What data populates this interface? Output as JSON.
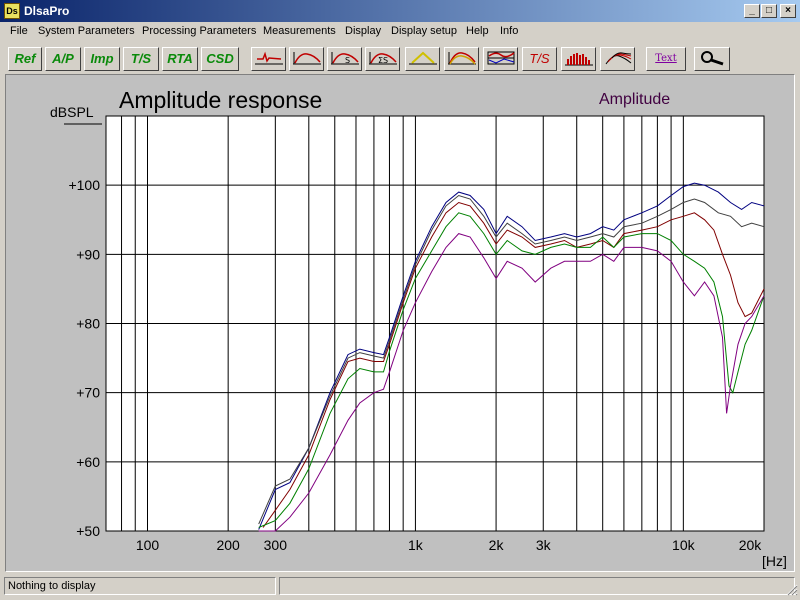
{
  "window": {
    "title": "DlsaPro",
    "app_icon": "Ds"
  },
  "menu": [
    "File",
    "System Parameters",
    "Processing Parameters",
    "Measurements",
    "Display",
    "Display setup",
    "Help",
    "Info"
  ],
  "toolbar": {
    "text_buttons": [
      "Ref",
      "A/P",
      "Imp",
      "T/S",
      "RTA",
      "CSD"
    ],
    "icon_buttons": [
      "impulse-icon",
      "amplitude-icon",
      "sigma-icon",
      "sum-sigma-icon",
      "window-icon",
      "double-curve-icon",
      "phase-icon",
      "ts-icon",
      "rta-bars-icon",
      "waterfall-icon"
    ],
    "ts_icon_label": "T/S",
    "text_tool_label": "Text",
    "zoom_icon": "magnifier-icon"
  },
  "chart_data": {
    "type": "line",
    "title": "Amplitude response",
    "legend_label": "Amplitude",
    "ylabel": "dBSPL",
    "xlabel": "[Hz]",
    "xscale": "log",
    "xlim": [
      70,
      20000
    ],
    "ylim": [
      50,
      110
    ],
    "grid": true,
    "x_ticks": [
      {
        "value": 100,
        "label": "100"
      },
      {
        "value": 200,
        "label": "200"
      },
      {
        "value": 300,
        "label": "300"
      },
      {
        "value": 1000,
        "label": "1k"
      },
      {
        "value": 2000,
        "label": "2k"
      },
      {
        "value": 3000,
        "label": "3k"
      },
      {
        "value": 10000,
        "label": "10k"
      },
      {
        "value": 20000,
        "label": "20k"
      }
    ],
    "y_ticks": [
      {
        "value": 50,
        "label": "+50"
      },
      {
        "value": 60,
        "label": "+60"
      },
      {
        "value": 70,
        "label": "+70"
      },
      {
        "value": 80,
        "label": "+80"
      },
      {
        "value": 90,
        "label": "+90"
      },
      {
        "value": 100,
        "label": "+100"
      }
    ],
    "colors": {
      "background": "#ffffff",
      "grid": "#000000",
      "title": "#000000",
      "legend": "#400040"
    },
    "series": [
      {
        "color": "#000080",
        "points": [
          [
            260,
            50.2
          ],
          [
            300,
            56
          ],
          [
            340,
            57
          ],
          [
            400,
            62
          ],
          [
            480,
            70
          ],
          [
            560,
            75.5
          ],
          [
            620,
            76.3
          ],
          [
            700,
            75.8
          ],
          [
            760,
            75.5
          ],
          [
            800,
            78
          ],
          [
            900,
            84
          ],
          [
            1000,
            89
          ],
          [
            1150,
            94
          ],
          [
            1300,
            97.5
          ],
          [
            1450,
            99
          ],
          [
            1600,
            98.5
          ],
          [
            1800,
            96.5
          ],
          [
            2000,
            93
          ],
          [
            2200,
            95.5
          ],
          [
            2500,
            94
          ],
          [
            2800,
            92
          ],
          [
            3200,
            92.5
          ],
          [
            3600,
            93
          ],
          [
            4000,
            92.5
          ],
          [
            4500,
            93
          ],
          [
            5000,
            94
          ],
          [
            5500,
            93.5
          ],
          [
            6000,
            95
          ],
          [
            7000,
            96
          ],
          [
            8000,
            97
          ],
          [
            9000,
            98.5
          ],
          [
            10000,
            99.8
          ],
          [
            11000,
            100.3
          ],
          [
            12000,
            100
          ],
          [
            13500,
            99
          ],
          [
            15000,
            97.5
          ],
          [
            16500,
            96.5
          ],
          [
            18000,
            97.5
          ],
          [
            20000,
            97
          ]
        ]
      },
      {
        "color": "#404040",
        "points": [
          [
            260,
            51
          ],
          [
            300,
            56.5
          ],
          [
            340,
            57.5
          ],
          [
            400,
            62
          ],
          [
            480,
            69.5
          ],
          [
            560,
            75
          ],
          [
            620,
            75.8
          ],
          [
            700,
            75.3
          ],
          [
            760,
            75
          ],
          [
            800,
            77.5
          ],
          [
            900,
            83.5
          ],
          [
            1000,
            88.5
          ],
          [
            1150,
            93.5
          ],
          [
            1300,
            97
          ],
          [
            1450,
            98.5
          ],
          [
            1600,
            98
          ],
          [
            1800,
            95.5
          ],
          [
            2000,
            92.5
          ],
          [
            2200,
            94.5
          ],
          [
            2500,
            93
          ],
          [
            2800,
            91.5
          ],
          [
            3200,
            92
          ],
          [
            3600,
            92.5
          ],
          [
            4000,
            92
          ],
          [
            4500,
            92.5
          ],
          [
            5000,
            93
          ],
          [
            5500,
            92.5
          ],
          [
            6000,
            94
          ],
          [
            7000,
            94.5
          ],
          [
            8000,
            95.5
          ],
          [
            9000,
            96.5
          ],
          [
            10000,
            97.5
          ],
          [
            11000,
            98
          ],
          [
            12000,
            97.5
          ],
          [
            13500,
            96
          ],
          [
            15000,
            95.5
          ],
          [
            16500,
            94
          ],
          [
            18000,
            94.5
          ],
          [
            20000,
            94
          ]
        ]
      },
      {
        "color": "#800000",
        "points": [
          [
            270,
            50.5
          ],
          [
            300,
            53
          ],
          [
            340,
            56
          ],
          [
            400,
            61
          ],
          [
            480,
            69
          ],
          [
            560,
            74.5
          ],
          [
            620,
            75
          ],
          [
            700,
            74.5
          ],
          [
            760,
            74.5
          ],
          [
            800,
            77
          ],
          [
            900,
            83
          ],
          [
            1000,
            88
          ],
          [
            1150,
            92.5
          ],
          [
            1300,
            96
          ],
          [
            1450,
            97.5
          ],
          [
            1600,
            97
          ],
          [
            1800,
            94.5
          ],
          [
            2000,
            91.5
          ],
          [
            2200,
            93.5
          ],
          [
            2500,
            92.5
          ],
          [
            2800,
            91
          ],
          [
            3200,
            91.5
          ],
          [
            3600,
            92
          ],
          [
            4000,
            91
          ],
          [
            4500,
            91.5
          ],
          [
            5000,
            92
          ],
          [
            5500,
            91
          ],
          [
            6000,
            93
          ],
          [
            7000,
            93.5
          ],
          [
            8000,
            94
          ],
          [
            9000,
            95
          ],
          [
            10000,
            95.5
          ],
          [
            11000,
            96
          ],
          [
            12000,
            95
          ],
          [
            13000,
            93.5
          ],
          [
            14000,
            90
          ],
          [
            15000,
            87
          ],
          [
            16000,
            83
          ],
          [
            17000,
            81
          ],
          [
            18000,
            81.5
          ],
          [
            20000,
            85
          ]
        ]
      },
      {
        "color": "#008000",
        "points": [
          [
            260,
            50.5
          ],
          [
            300,
            51.5
          ],
          [
            340,
            54
          ],
          [
            400,
            59
          ],
          [
            480,
            67
          ],
          [
            560,
            72
          ],
          [
            620,
            73.5
          ],
          [
            700,
            73
          ],
          [
            760,
            73
          ],
          [
            800,
            76
          ],
          [
            900,
            82
          ],
          [
            1000,
            86.5
          ],
          [
            1150,
            90.5
          ],
          [
            1300,
            94
          ],
          [
            1450,
            96
          ],
          [
            1600,
            95.5
          ],
          [
            1800,
            93
          ],
          [
            2000,
            90
          ],
          [
            2200,
            92
          ],
          [
            2500,
            90.5
          ],
          [
            2800,
            90
          ],
          [
            3200,
            91
          ],
          [
            3600,
            91.5
          ],
          [
            4000,
            91
          ],
          [
            4500,
            91
          ],
          [
            5000,
            92.5
          ],
          [
            5500,
            91
          ],
          [
            6000,
            92.5
          ],
          [
            7000,
            93
          ],
          [
            8000,
            93
          ],
          [
            9000,
            92
          ],
          [
            10000,
            90
          ],
          [
            11000,
            89
          ],
          [
            12000,
            88
          ],
          [
            13000,
            86
          ],
          [
            14000,
            81
          ],
          [
            14800,
            71
          ],
          [
            15300,
            70
          ],
          [
            16000,
            73
          ],
          [
            17000,
            77
          ],
          [
            18000,
            79
          ],
          [
            20000,
            84
          ]
        ]
      },
      {
        "color": "#800080",
        "points": [
          [
            260,
            50
          ],
          [
            300,
            50
          ],
          [
            340,
            52
          ],
          [
            400,
            55.5
          ],
          [
            480,
            61
          ],
          [
            560,
            66
          ],
          [
            620,
            68.5
          ],
          [
            700,
            70
          ],
          [
            760,
            70.5
          ],
          [
            800,
            73
          ],
          [
            900,
            79
          ],
          [
            1000,
            83
          ],
          [
            1150,
            87.5
          ],
          [
            1300,
            91
          ],
          [
            1450,
            93
          ],
          [
            1600,
            92.5
          ],
          [
            1800,
            89.5
          ],
          [
            2000,
            86.5
          ],
          [
            2200,
            89
          ],
          [
            2500,
            88
          ],
          [
            2800,
            86
          ],
          [
            3200,
            88
          ],
          [
            3600,
            89
          ],
          [
            4000,
            89
          ],
          [
            4500,
            89
          ],
          [
            5000,
            90
          ],
          [
            5500,
            89
          ],
          [
            6000,
            91
          ],
          [
            7000,
            91
          ],
          [
            8000,
            90.5
          ],
          [
            9000,
            89
          ],
          [
            10000,
            86
          ],
          [
            11000,
            84
          ],
          [
            12000,
            86
          ],
          [
            13000,
            84
          ],
          [
            14000,
            78
          ],
          [
            14500,
            67
          ],
          [
            15000,
            71
          ],
          [
            16000,
            77
          ],
          [
            17000,
            80
          ],
          [
            18000,
            81
          ],
          [
            20000,
            84
          ]
        ]
      }
    ]
  },
  "status": {
    "message": "Nothing to display"
  }
}
